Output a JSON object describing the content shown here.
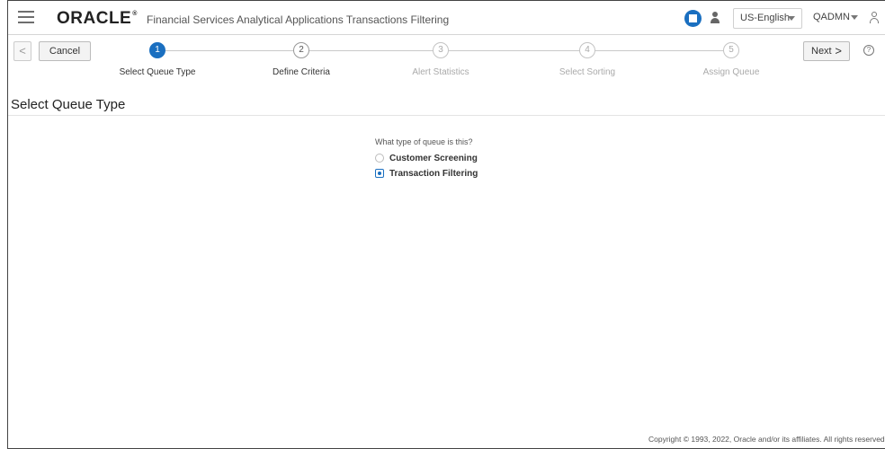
{
  "header": {
    "logo_text": "ORACLE",
    "logo_mark": "®",
    "app_title": "Financial Services Analytical Applications Transactions Filtering",
    "language": "US-English",
    "user": "QADMN"
  },
  "train": {
    "back_symbol": "<",
    "cancel_label": "Cancel",
    "next_label": "Next",
    "next_symbol": ">",
    "help_symbol": "?",
    "steps": [
      {
        "number": "1",
        "label": "Select Queue Type",
        "state": "active"
      },
      {
        "number": "2",
        "label": "Define Criteria",
        "state": "enabled"
      },
      {
        "number": "3",
        "label": "Alert Statistics",
        "state": "disabled"
      },
      {
        "number": "4",
        "label": "Select Sorting",
        "state": "disabled"
      },
      {
        "number": "5",
        "label": "Assign Queue",
        "state": "disabled"
      }
    ]
  },
  "main": {
    "page_title": "Select Queue Type",
    "question": "What type of queue is this?",
    "options": [
      {
        "label": "Customer Screening",
        "selected": false
      },
      {
        "label": "Transaction Filtering",
        "selected": true
      }
    ]
  },
  "footer": {
    "copyright": "Copyright © 1993, 2022, Oracle and/or its affiliates. All rights reserved."
  },
  "colors": {
    "accent": "#1a6fc0"
  }
}
